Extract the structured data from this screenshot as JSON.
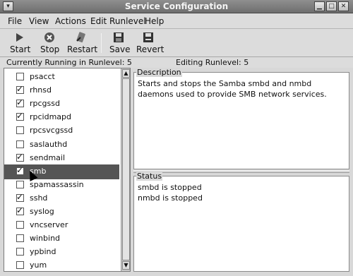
{
  "window": {
    "title": "Service Configuration"
  },
  "titlebar_buttons": [
    "minimize-icon",
    "maximize-icon",
    "close-icon"
  ],
  "menu": [
    "File",
    "View",
    "Actions",
    "Edit Runlevel",
    "Help"
  ],
  "toolbar": {
    "start": "Start",
    "stop": "Stop",
    "restart": "Restart",
    "save": "Save",
    "revert": "Revert"
  },
  "status": {
    "running": "Currently Running in Runlevel: 5",
    "editing": "Editing Runlevel: 5"
  },
  "services": [
    {
      "name": "psacct",
      "checked": false
    },
    {
      "name": "rhnsd",
      "checked": true
    },
    {
      "name": "rpcgssd",
      "checked": true
    },
    {
      "name": "rpcidmapd",
      "checked": true
    },
    {
      "name": "rpcsvcgssd",
      "checked": false
    },
    {
      "name": "saslauthd",
      "checked": false
    },
    {
      "name": "sendmail",
      "checked": true
    },
    {
      "name": "smb",
      "checked": true,
      "selected": true
    },
    {
      "name": "spamassassin",
      "checked": false
    },
    {
      "name": "sshd",
      "checked": true
    },
    {
      "name": "syslog",
      "checked": true
    },
    {
      "name": "vncserver",
      "checked": false
    },
    {
      "name": "winbind",
      "checked": false
    },
    {
      "name": "ypbind",
      "checked": false
    },
    {
      "name": "yum",
      "checked": false
    }
  ],
  "description": {
    "label": "Description",
    "text": "Starts and stops the Samba smbd and nmbd daemons used to provide SMB network services."
  },
  "statuspane": {
    "label": "Status",
    "lines": [
      "smbd is stopped",
      "nmbd is stopped"
    ]
  },
  "colors": {
    "selection": "#555555",
    "titlebar": "#7a7a7a",
    "accent_stop": "#b02020"
  }
}
